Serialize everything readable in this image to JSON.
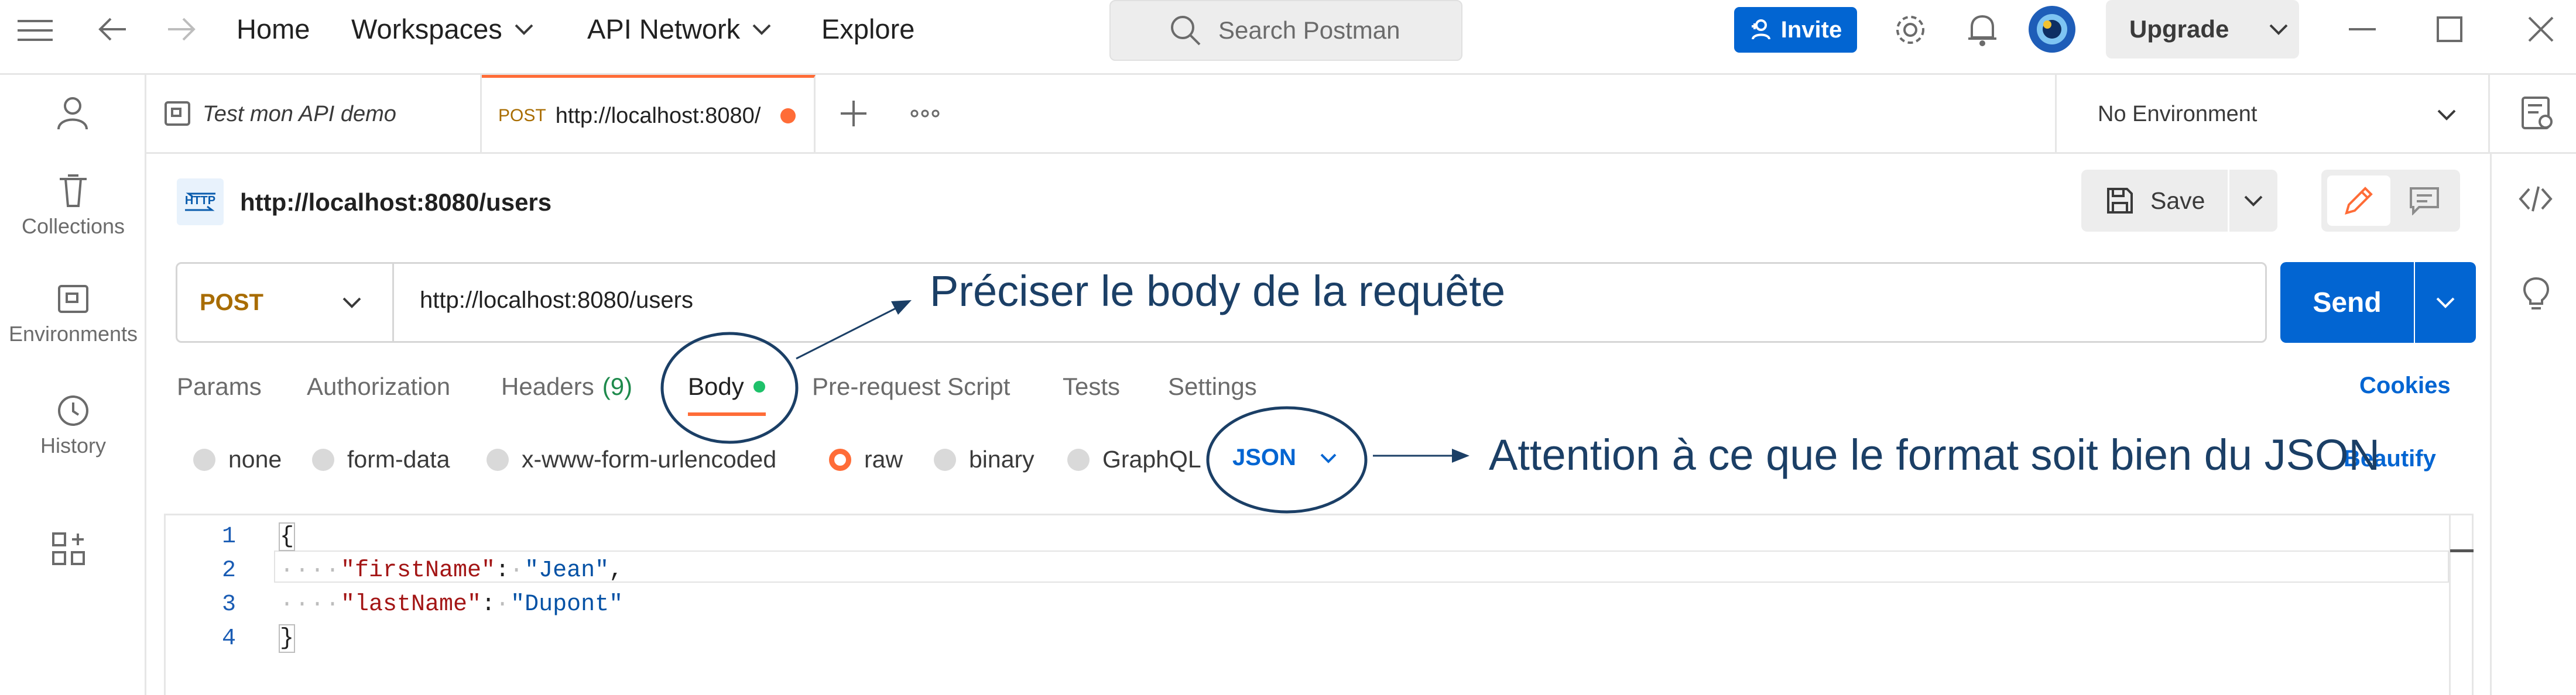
{
  "nav": {
    "home": "Home",
    "workspaces": "Workspaces",
    "api_network": "API Network",
    "explore": "Explore"
  },
  "search": {
    "placeholder": "Search Postman"
  },
  "actions": {
    "invite": "Invite",
    "upgrade": "Upgrade"
  },
  "sidebar": {
    "items": [
      {
        "label": "Collections",
        "icon": "trash-can-icon"
      },
      {
        "label": "Environments",
        "icon": "environment-icon"
      },
      {
        "label": "History",
        "icon": "history-icon"
      }
    ]
  },
  "tabs": {
    "items": [
      {
        "label": "Test mon API demo"
      },
      {
        "method": "POST",
        "label": "http://localhost:8080/"
      }
    ]
  },
  "environment": {
    "selected": "No Environment"
  },
  "request": {
    "title": "http://localhost:8080/users",
    "save": "Save",
    "method": "POST",
    "url": "http://localhost:8080/users",
    "send": "Send"
  },
  "request_tabs": {
    "params": "Params",
    "authorization": "Authorization",
    "headers": "Headers",
    "headers_count": "(9)",
    "body": "Body",
    "prerequest": "Pre-request Script",
    "tests": "Tests",
    "settings": "Settings",
    "cookies": "Cookies"
  },
  "body_types": {
    "none": "none",
    "form_data": "form-data",
    "urlencoded": "x-www-form-urlencoded",
    "raw": "raw",
    "binary": "binary",
    "graphql": "GraphQL",
    "format": "JSON",
    "beautify": "Beautify"
  },
  "editor": {
    "lines": [
      {
        "n": "1",
        "text": "{"
      },
      {
        "n": "2",
        "key": "\"firstName\"",
        "value": "\"Jean\"",
        "trail": ","
      },
      {
        "n": "3",
        "key": "\"lastName\"",
        "value": "\"Dupont\"",
        "trail": ""
      },
      {
        "n": "4",
        "text": "}"
      }
    ]
  },
  "annotations": {
    "body": "Préciser le body de la requête",
    "format": "Attention à ce que le format soit bien du JSON"
  },
  "colors": {
    "accent": "#ff6c37",
    "primary": "#0265d2",
    "annotation": "#1b3f66"
  }
}
